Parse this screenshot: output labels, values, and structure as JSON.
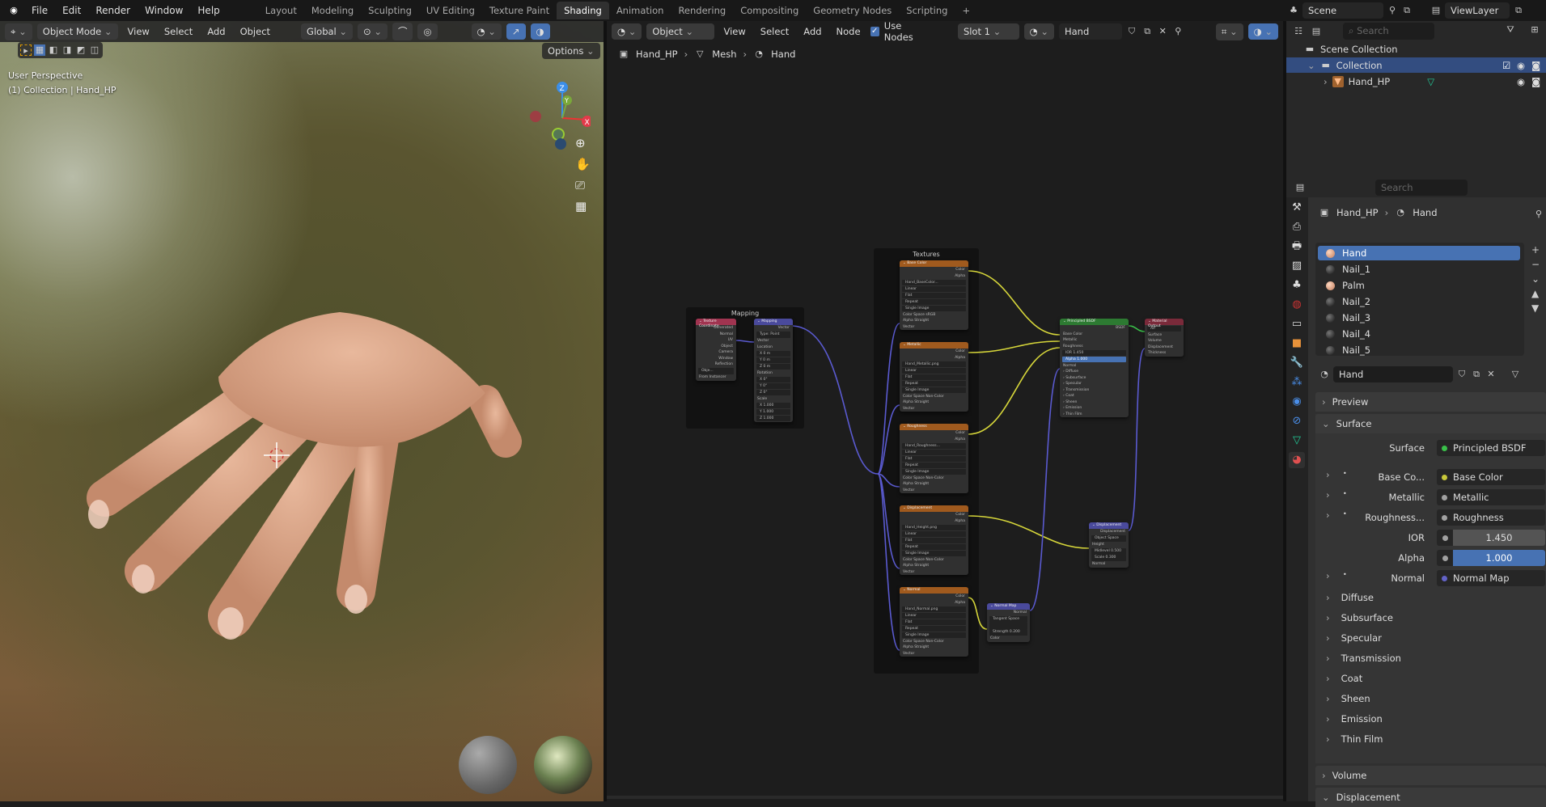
{
  "topbar": {
    "menus": [
      "File",
      "Edit",
      "Render",
      "Window",
      "Help"
    ],
    "workspaces": [
      "Layout",
      "Modeling",
      "Sculpting",
      "UV Editing",
      "Texture Paint",
      "Shading",
      "Animation",
      "Rendering",
      "Compositing",
      "Geometry Nodes",
      "Scripting"
    ],
    "active_workspace": "Shading",
    "add_tab": "+",
    "scene": "Scene",
    "view_layer": "ViewLayer"
  },
  "viewport": {
    "mode": "Object Mode",
    "menus": [
      "View",
      "Select",
      "Add",
      "Object"
    ],
    "orientation": "Global",
    "options": "Options",
    "view_name": "User Perspective",
    "collection_info": "(1) Collection | Hand_HP",
    "gizmo": {
      "z": "Z",
      "y": "Y",
      "x": "X"
    }
  },
  "node_editor": {
    "object_type": "Object",
    "menus": [
      "View",
      "Select",
      "Add",
      "Node"
    ],
    "use_nodes_label": "Use Nodes",
    "use_nodes": true,
    "slot": "Slot 1",
    "material": "Hand",
    "breadcrumb": [
      "Hand_HP",
      "Mesh",
      "Hand"
    ],
    "frames": {
      "mapping": "Mapping",
      "textures": "Textures"
    },
    "nodes": {
      "texcoord": {
        "title": "Texture Coordinate",
        "rows": [
          [
            "out",
            "Generated"
          ],
          [
            "out",
            "Normal"
          ],
          [
            "out",
            "UV"
          ],
          [
            "out",
            "Object"
          ],
          [
            "out",
            "Camera"
          ],
          [
            "out",
            "Window"
          ],
          [
            "out",
            "Reflection"
          ],
          [
            "f",
            "Obje..."
          ],
          [
            "in",
            "From Instancer"
          ]
        ]
      },
      "mapping": {
        "title": "Mapping",
        "rows": [
          [
            "out",
            "Vector"
          ],
          [
            "f",
            "Type: Point"
          ],
          [
            "in",
            "Vector"
          ],
          [
            "in",
            "Location"
          ],
          [
            "f",
            "X 0 m"
          ],
          [
            "f",
            "Y 0 m"
          ],
          [
            "f",
            "Z 0 m"
          ],
          [
            "in",
            "Rotation"
          ],
          [
            "f",
            "X 0°"
          ],
          [
            "f",
            "Y 0°"
          ],
          [
            "f",
            "Z 0°"
          ],
          [
            "in",
            "Scale"
          ],
          [
            "f",
            "X 1.000"
          ],
          [
            "f",
            "Y 1.000"
          ],
          [
            "f",
            "Z 1.000"
          ]
        ]
      },
      "basecolor": {
        "title": "Base Color",
        "rows": [
          [
            "out",
            "Color"
          ],
          [
            "out",
            "Alpha"
          ],
          [
            "f",
            "Hand_BaseColor..."
          ],
          [
            "f",
            "Linear"
          ],
          [
            "f",
            "Flat"
          ],
          [
            "f",
            "Repeat"
          ],
          [
            "f",
            "Single Image"
          ],
          [
            "in",
            "Color Space   sRGB"
          ],
          [
            "in",
            "Alpha   Straight"
          ],
          [
            "in",
            "Vector"
          ]
        ]
      },
      "metallic": {
        "title": "Metallic",
        "rows": [
          [
            "out",
            "Color"
          ],
          [
            "out",
            "Alpha"
          ],
          [
            "f",
            "Hand_Metallic.png"
          ],
          [
            "f",
            "Linear"
          ],
          [
            "f",
            "Flat"
          ],
          [
            "f",
            "Repeat"
          ],
          [
            "f",
            "Single Image"
          ],
          [
            "in",
            "Color Space   Non-Color"
          ],
          [
            "in",
            "Alpha   Straight"
          ],
          [
            "in",
            "Vector"
          ]
        ]
      },
      "roughness": {
        "title": "Roughness",
        "rows": [
          [
            "out",
            "Color"
          ],
          [
            "out",
            "Alpha"
          ],
          [
            "f",
            "Hand_Roughness..."
          ],
          [
            "f",
            "Linear"
          ],
          [
            "f",
            "Flat"
          ],
          [
            "f",
            "Repeat"
          ],
          [
            "f",
            "Single Image"
          ],
          [
            "in",
            "Color Space   Non-Color"
          ],
          [
            "in",
            "Alpha   Straight"
          ],
          [
            "in",
            "Vector"
          ]
        ]
      },
      "disptex": {
        "title": "Displacement",
        "rows": [
          [
            "out",
            "Color"
          ],
          [
            "out",
            "Alpha"
          ],
          [
            "f",
            "Hand_Height.png"
          ],
          [
            "f",
            "Linear"
          ],
          [
            "f",
            "Flat"
          ],
          [
            "f",
            "Repeat"
          ],
          [
            "f",
            "Single Image"
          ],
          [
            "in",
            "Color Space   Non-Color"
          ],
          [
            "in",
            "Alpha   Straight"
          ],
          [
            "in",
            "Vector"
          ]
        ]
      },
      "normaltex": {
        "title": "Normal",
        "rows": [
          [
            "out",
            "Color"
          ],
          [
            "out",
            "Alpha"
          ],
          [
            "f",
            "Hand_Normal.png"
          ],
          [
            "f",
            "Linear"
          ],
          [
            "f",
            "Flat"
          ],
          [
            "f",
            "Repeat"
          ],
          [
            "f",
            "Single Image"
          ],
          [
            "in",
            "Color Space   Non-Color"
          ],
          [
            "in",
            "Alpha   Straight"
          ],
          [
            "in",
            "Vector"
          ]
        ]
      },
      "bsdf": {
        "title": "Principled BSDF",
        "rows": [
          [
            "out",
            "BSDF"
          ],
          [
            "in",
            "Base Color"
          ],
          [
            "in",
            "Metallic"
          ],
          [
            "in",
            "Roughness"
          ],
          [
            "f",
            "IOR   1.450"
          ],
          [
            "hi",
            "Alpha   1.000"
          ],
          [
            "in",
            "Normal"
          ],
          [
            "in",
            "› Diffuse"
          ],
          [
            "in",
            "› Subsurface"
          ],
          [
            "in",
            "› Specular"
          ],
          [
            "in",
            "› Transmission"
          ],
          [
            "in",
            "› Coat"
          ],
          [
            "in",
            "› Sheen"
          ],
          [
            "in",
            "› Emission"
          ],
          [
            "in",
            "› Thin Film"
          ]
        ]
      },
      "matout": {
        "title": "Material Output",
        "rows": [
          [
            "f",
            "All"
          ],
          [
            "in",
            "Surface"
          ],
          [
            "in",
            "Volume"
          ],
          [
            "in",
            "Displacement"
          ],
          [
            "in",
            "Thickness"
          ]
        ]
      },
      "normalmap": {
        "title": "Normal Map",
        "rows": [
          [
            "out",
            "Normal"
          ],
          [
            "f",
            "Tangent Space"
          ],
          [
            "f",
            ""
          ],
          [
            "f",
            "Strength   0.200"
          ],
          [
            "in",
            "Color"
          ]
        ]
      },
      "dispnode": {
        "title": "Displacement",
        "rows": [
          [
            "out",
            "Displacement"
          ],
          [
            "f",
            "Object Space"
          ],
          [
            "in",
            "Height"
          ],
          [
            "f",
            "Midlevel   0.500"
          ],
          [
            "f",
            "Scale   0.300"
          ],
          [
            "in",
            "Normal"
          ]
        ]
      }
    }
  },
  "outliner": {
    "search_placeholder": "Search",
    "scene_collection": "Scene Collection",
    "collection": "Collection",
    "object": "Hand_HP"
  },
  "properties": {
    "search_placeholder": "Search",
    "breadcrumb": [
      "Hand_HP",
      "Hand"
    ],
    "materials": [
      {
        "name": "Hand",
        "tone": "skin"
      },
      {
        "name": "Nail_1",
        "tone": "dark"
      },
      {
        "name": "Palm",
        "tone": "skin"
      },
      {
        "name": "Nail_2",
        "tone": "dark"
      },
      {
        "name": "Nail_3",
        "tone": "dark"
      },
      {
        "name": "Nail_4",
        "tone": "dark"
      },
      {
        "name": "Nail_5",
        "tone": "dark"
      }
    ],
    "material_name": "Hand",
    "panels": {
      "preview": "Preview",
      "surface": "Surface",
      "volume": "Volume",
      "displacement": "Displacement"
    },
    "surface_label": "Surface",
    "surface_value": "Principled BSDF",
    "inputs": [
      {
        "label": "Base Co...",
        "value": "Base Color",
        "color": "#c8c83a"
      },
      {
        "label": "Metallic",
        "value": "Metallic",
        "color": "#a1a1a1"
      },
      {
        "label": "Roughness...",
        "value": "Roughness",
        "color": "#a1a1a1"
      }
    ],
    "ior": {
      "label": "IOR",
      "value": "1.450"
    },
    "alpha": {
      "label": "Alpha",
      "value": "1.000",
      "fraction": 1.0
    },
    "normal": {
      "label": "Normal",
      "value": "Normal Map",
      "color": "#6363c7"
    },
    "subpanels": [
      "Diffuse",
      "Subsurface",
      "Specular",
      "Transmission",
      "Coat",
      "Sheen",
      "Emission",
      "Thin Film"
    ]
  }
}
